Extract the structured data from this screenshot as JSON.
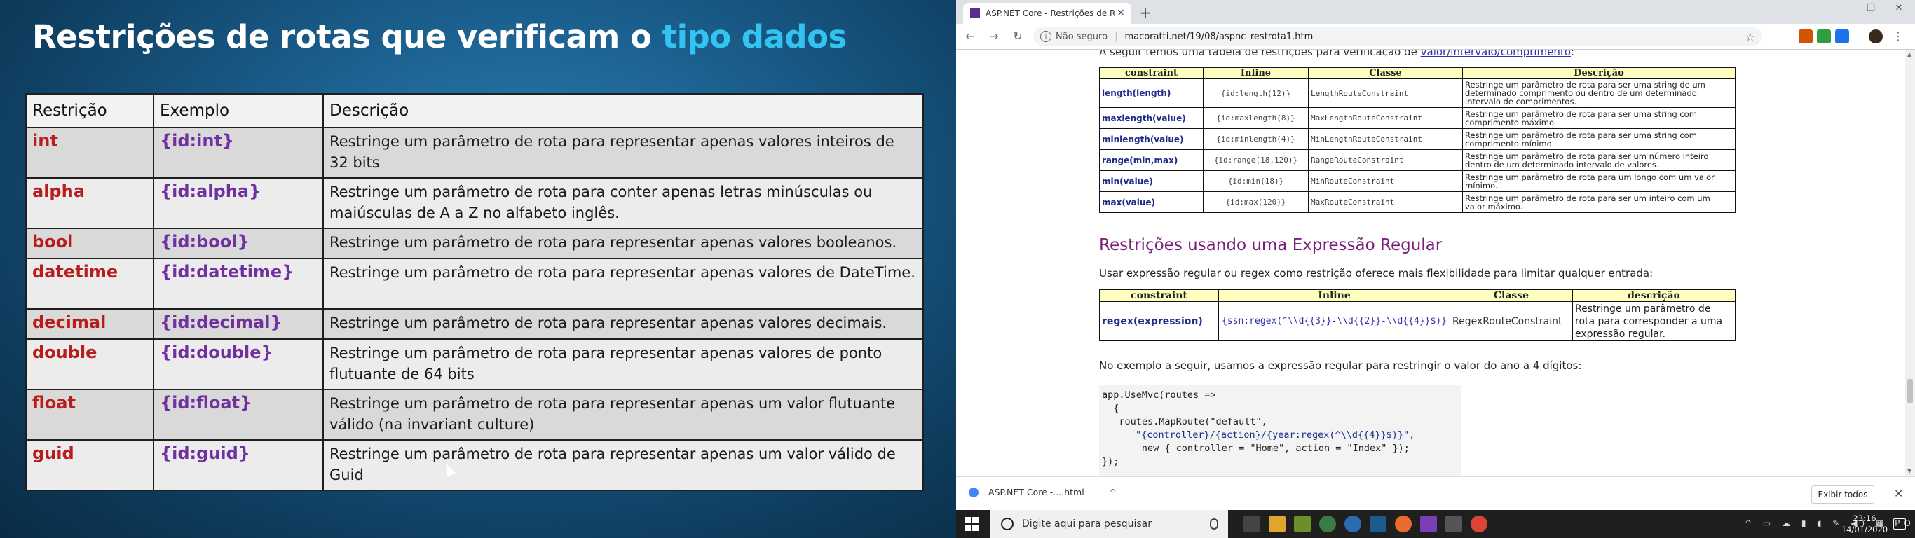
{
  "slide": {
    "title_main": "Restrições de rotas que  verificam o ",
    "title_highlight": "tipo dados",
    "columns": [
      "Restrição",
      "Exemplo",
      "Descrição"
    ],
    "rows": [
      {
        "name": "int",
        "example": "{id:int}",
        "desc": "Restringe um parâmetro de rota para representar apenas valores inteiros de 32 bits"
      },
      {
        "name": "alpha",
        "example": "{id:alpha}",
        "desc": "Restringe um parâmetro de rota para conter apenas letras minúsculas ou maiúsculas de A a Z no alfabeto inglês."
      },
      {
        "name": "bool",
        "example": "{id:bool}",
        "desc": "Restringe um parâmetro de rota para representar apenas valores booleanos."
      },
      {
        "name": "datetime",
        "example": "{id:datetime}",
        "desc": "Restringe um parâmetro de rota para representar apenas valores de DateTime."
      },
      {
        "name": "decimal",
        "example": "{id:decimal}",
        "desc": "Restringe um parâmetro de rota para representar apenas valores decimais."
      },
      {
        "name": "double",
        "example": "{id:double}",
        "desc": "Restringe um parâmetro de rota para representar apenas valores de ponto flutuante de 64 bits"
      },
      {
        "name": "float",
        "example": "{id:float}",
        "desc": "Restringe um parâmetro de rota para representar apenas um valor flutuante válido (na invariant culture)"
      },
      {
        "name": "guid",
        "example": "{id:guid}",
        "desc": "Restringe um parâmetro de rota para representar apenas um valor válido de Guid"
      }
    ]
  },
  "browser": {
    "tab_title": "ASP.NET Core - Restrições de R",
    "tab_favicon": "aspnet-favicon",
    "new_tab": "+",
    "window_min": "–",
    "window_max": "❐",
    "window_close": "✕",
    "security_label": "Não seguro",
    "url": "macoratti.net/19/08/aspnc_restrota1.htm",
    "page": {
      "intro_cut": "A seguir temos uma tabela de restrições para verificação de ",
      "intro_link": "valor/intervalo/comprimento",
      "intro_end": ":",
      "table_a_headers": [
        "constraint",
        "Inline",
        "Classe",
        "Descrição"
      ],
      "table_a_rows": [
        {
          "c": "length(length)",
          "i": "{id:length(12)}",
          "k": "LengthRouteConstraint",
          "d": "Restringe um parâmetro de rota para ser uma string de um determinado comprimento ou dentro de um determinado intervalo de comprimentos."
        },
        {
          "c": "maxlength(value)",
          "i": "{id:maxlength(8)}",
          "k": "MaxLengthRouteConstraint",
          "d": "Restringe um parâmetro de rota para ser uma string com comprimento máximo."
        },
        {
          "c": "minlength(value)",
          "i": "{id:minlength(4)}",
          "k": "MinLengthRouteConstraint",
          "d": "Restringe um parâmetro de rota para ser uma string com comprimento mínimo."
        },
        {
          "c": "range(min,max)",
          "i": "{id:range(18,120)}",
          "k": "RangeRouteConstraint",
          "d": "Restringe um parâmetro de rota para ser um número inteiro dentro de um determinado intervalo de valores."
        },
        {
          "c": "min(value)",
          "i": "{id:min(18)}",
          "k": "MinRouteConstraint",
          "d": "Restringe um parâmetro de rota para um longo com um valor mínimo."
        },
        {
          "c": "max(value)",
          "i": "{id:max(120)}",
          "k": "MaxRouteConstraint",
          "d": "Restringe um parâmetro de rota para ser um inteiro com um valor máximo."
        }
      ],
      "regex_heading": "Restrições usando uma Expressão Regular",
      "regex_intro": "Usar expressão regular ou regex como restrição oferece mais flexibilidade para limitar qualquer entrada:",
      "table_b_headers": [
        "constraint",
        "Inline",
        "Classe",
        "descrição"
      ],
      "table_b_row": {
        "c": "regex(expression)",
        "i": "{ssn:regex(^\\\\d{{3}}-\\\\d{{2}}-\\\\d{{4}}$)}",
        "k": "RegexRouteConstraint",
        "d": "Restringe um parâmetro de rota para corresponder a uma expressão regular."
      },
      "example_text": "No exemplo a seguir, usamos a expressão regular para restringir o valor do ano a 4 dígitos:",
      "code_l1": "app.UseMvc(routes =>",
      "code_l2": "  {",
      "code_l3": "   routes.MapRoute(\"default\",",
      "code_l4": "\"{controller}/{action}/{year:regex(^\\\\d{{4}}$)}\",",
      "code_l5": "       new { controller = \"Home\", action = \"Index\" });",
      "code_l6": "});"
    },
    "download": {
      "filename": "ASP.NET Core -....html",
      "chevron": "^",
      "show_all": "Exibir todos",
      "close": "✕"
    }
  },
  "taskbar": {
    "search_placeholder": "Digite aqui para pesquisar",
    "time": "23:16",
    "date": "14/01/2020",
    "tray": "^ ▭ ☁ ▮ ◖ ✎ ◀) ▦ POR"
  },
  "colors": {
    "slide_title_highlight": "#33c3f0",
    "restriction_name": "#b81c1c",
    "restriction_example": "#7030a0",
    "heading_purple": "#7a1f7a",
    "table_header_yellow": "#ffffc0"
  }
}
